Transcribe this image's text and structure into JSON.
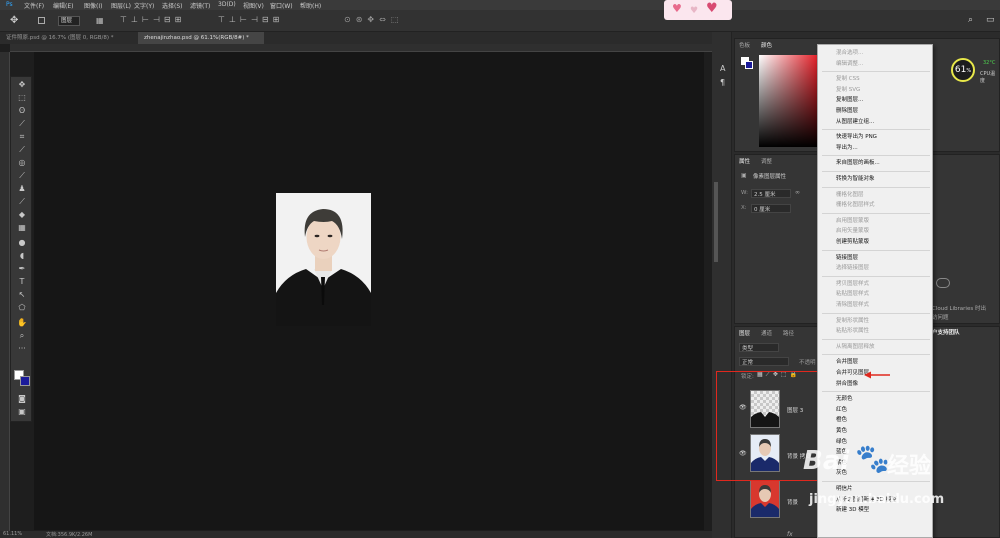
{
  "menubar": {
    "items": [
      "文件(F)",
      "编辑(E)",
      "图像(I)",
      "图层(L)",
      "文字(Y)",
      "选择(S)",
      "滤镜(T)",
      "3D(D)",
      "视图(V)",
      "窗口(W)",
      "帮助(H)"
    ]
  },
  "options": {
    "auto_select_value": "图层"
  },
  "tabs": [
    {
      "label": "证件照原.psd @ 16.7% (图层 0, RGB/8) *"
    },
    {
      "label": "zhenajinzhao.psd @ 61.1%(RGB/8#) *"
    }
  ],
  "status": {
    "zoom": "61.11%",
    "doc": "文档:356.9K/2.26M"
  },
  "right": {
    "color_tabs": [
      "色板",
      "颜色"
    ],
    "properties_tabs": [
      "属性",
      "调整"
    ],
    "properties_title": "像素图层属性",
    "w_label": "W:",
    "w_value": "2.5 厘米",
    "x_label": "X:",
    "x_value": "0 厘米",
    "layers_tabs": [
      "图层",
      "通道",
      "路径"
    ],
    "kind": "类型",
    "blend": "正常",
    "opacity_label": "不透明",
    "lock_label": "锁定:",
    "cloud_text": "Cloud Libraries 时出",
    "cloud_sub": "访问题",
    "support": "户支持团队",
    "bottom_icon": "fx"
  },
  "cpu": {
    "percent": "61",
    "unit": "%",
    "temp": "32°C",
    "label": "CPU温度"
  },
  "layers": [
    {
      "name": "图层 3"
    },
    {
      "name": "背景 拷贝"
    },
    {
      "name": "背景"
    }
  ],
  "context_menu": [
    {
      "label": "混合选项...",
      "dis": true
    },
    {
      "label": "编辑调整...",
      "dis": true
    },
    {
      "sep": true
    },
    {
      "label": "复制 CSS",
      "dis": true
    },
    {
      "label": "复制 SVG",
      "dis": true
    },
    {
      "label": "复制图层...",
      "dis": false
    },
    {
      "label": "删除图层",
      "dis": false
    },
    {
      "label": "从图层建立组...",
      "dis": false
    },
    {
      "sep": true
    },
    {
      "label": "快速导出为 PNG",
      "dis": false
    },
    {
      "label": "导出为...",
      "dis": false
    },
    {
      "sep": true
    },
    {
      "label": "来自图层的画板...",
      "dis": false
    },
    {
      "sep": true
    },
    {
      "label": "转换为智能对象",
      "dis": false
    },
    {
      "sep": true
    },
    {
      "label": "栅格化图层",
      "dis": true
    },
    {
      "label": "栅格化图层样式",
      "dis": true
    },
    {
      "sep": true
    },
    {
      "label": "启用图层蒙版",
      "dis": true
    },
    {
      "label": "启用矢量蒙版",
      "dis": true
    },
    {
      "label": "创建剪贴蒙版",
      "dis": false
    },
    {
      "sep": true
    },
    {
      "label": "链接图层",
      "dis": false
    },
    {
      "label": "选择链接图层",
      "dis": true
    },
    {
      "sep": true
    },
    {
      "label": "拷贝图层样式",
      "dis": true
    },
    {
      "label": "粘贴图层样式",
      "dis": true
    },
    {
      "label": "清除图层样式",
      "dis": true
    },
    {
      "sep": true
    },
    {
      "label": "复制形状属性",
      "dis": true
    },
    {
      "label": "粘贴形状属性",
      "dis": true
    },
    {
      "sep": true
    },
    {
      "label": "从隔离图层释放",
      "dis": true
    },
    {
      "sep": true
    },
    {
      "label": "合并图层",
      "dis": false
    },
    {
      "label": "合并可见图层",
      "dis": false
    },
    {
      "label": "拼合图像",
      "dis": false
    },
    {
      "sep": true
    },
    {
      "label": "无颜色",
      "dis": false
    },
    {
      "label": "红色",
      "dis": false
    },
    {
      "label": "橙色",
      "dis": false
    },
    {
      "label": "黄色",
      "dis": false
    },
    {
      "label": "绿色",
      "dis": false
    },
    {
      "label": "蓝色",
      "dis": false
    },
    {
      "label": "紫色",
      "dis": false
    },
    {
      "label": "灰色",
      "dis": false
    },
    {
      "sep": true
    },
    {
      "label": "明信片",
      "dis": false
    },
    {
      "label": "从所选图层新建 3D 模型",
      "dis": false
    },
    {
      "label": "新建 3D 模型",
      "dis": false
    }
  ],
  "watermark": {
    "brand": "Bai",
    "brand2": "经验",
    "url": "jingyan.baidu.com"
  },
  "colors": {
    "accent": "#e0281e",
    "canvas": "#161616",
    "panel": "#353535"
  }
}
